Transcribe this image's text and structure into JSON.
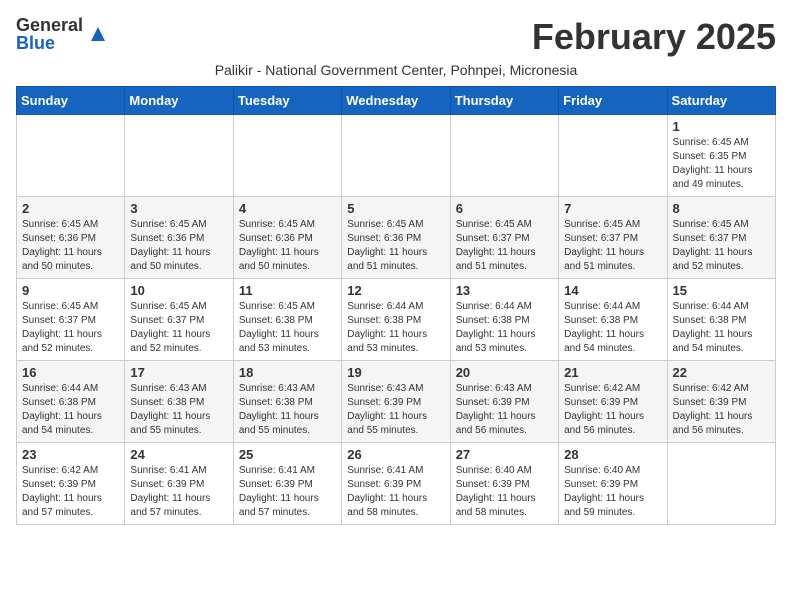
{
  "header": {
    "logo": {
      "general": "General",
      "blue": "Blue"
    },
    "title": "February 2025",
    "location": "Palikir - National Government Center, Pohnpei, Micronesia"
  },
  "weekdays": [
    "Sunday",
    "Monday",
    "Tuesday",
    "Wednesday",
    "Thursday",
    "Friday",
    "Saturday"
  ],
  "weeks": [
    [
      {
        "day": "",
        "info": ""
      },
      {
        "day": "",
        "info": ""
      },
      {
        "day": "",
        "info": ""
      },
      {
        "day": "",
        "info": ""
      },
      {
        "day": "",
        "info": ""
      },
      {
        "day": "",
        "info": ""
      },
      {
        "day": "1",
        "info": "Sunrise: 6:45 AM\nSunset: 6:35 PM\nDaylight: 11 hours and 49 minutes."
      }
    ],
    [
      {
        "day": "2",
        "info": "Sunrise: 6:45 AM\nSunset: 6:36 PM\nDaylight: 11 hours and 50 minutes."
      },
      {
        "day": "3",
        "info": "Sunrise: 6:45 AM\nSunset: 6:36 PM\nDaylight: 11 hours and 50 minutes."
      },
      {
        "day": "4",
        "info": "Sunrise: 6:45 AM\nSunset: 6:36 PM\nDaylight: 11 hours and 50 minutes."
      },
      {
        "day": "5",
        "info": "Sunrise: 6:45 AM\nSunset: 6:36 PM\nDaylight: 11 hours and 51 minutes."
      },
      {
        "day": "6",
        "info": "Sunrise: 6:45 AM\nSunset: 6:37 PM\nDaylight: 11 hours and 51 minutes."
      },
      {
        "day": "7",
        "info": "Sunrise: 6:45 AM\nSunset: 6:37 PM\nDaylight: 11 hours and 51 minutes."
      },
      {
        "day": "8",
        "info": "Sunrise: 6:45 AM\nSunset: 6:37 PM\nDaylight: 11 hours and 52 minutes."
      }
    ],
    [
      {
        "day": "9",
        "info": "Sunrise: 6:45 AM\nSunset: 6:37 PM\nDaylight: 11 hours and 52 minutes."
      },
      {
        "day": "10",
        "info": "Sunrise: 6:45 AM\nSunset: 6:37 PM\nDaylight: 11 hours and 52 minutes."
      },
      {
        "day": "11",
        "info": "Sunrise: 6:45 AM\nSunset: 6:38 PM\nDaylight: 11 hours and 53 minutes."
      },
      {
        "day": "12",
        "info": "Sunrise: 6:44 AM\nSunset: 6:38 PM\nDaylight: 11 hours and 53 minutes."
      },
      {
        "day": "13",
        "info": "Sunrise: 6:44 AM\nSunset: 6:38 PM\nDaylight: 11 hours and 53 minutes."
      },
      {
        "day": "14",
        "info": "Sunrise: 6:44 AM\nSunset: 6:38 PM\nDaylight: 11 hours and 54 minutes."
      },
      {
        "day": "15",
        "info": "Sunrise: 6:44 AM\nSunset: 6:38 PM\nDaylight: 11 hours and 54 minutes."
      }
    ],
    [
      {
        "day": "16",
        "info": "Sunrise: 6:44 AM\nSunset: 6:38 PM\nDaylight: 11 hours and 54 minutes."
      },
      {
        "day": "17",
        "info": "Sunrise: 6:43 AM\nSunset: 6:38 PM\nDaylight: 11 hours and 55 minutes."
      },
      {
        "day": "18",
        "info": "Sunrise: 6:43 AM\nSunset: 6:38 PM\nDaylight: 11 hours and 55 minutes."
      },
      {
        "day": "19",
        "info": "Sunrise: 6:43 AM\nSunset: 6:39 PM\nDaylight: 11 hours and 55 minutes."
      },
      {
        "day": "20",
        "info": "Sunrise: 6:43 AM\nSunset: 6:39 PM\nDaylight: 11 hours and 56 minutes."
      },
      {
        "day": "21",
        "info": "Sunrise: 6:42 AM\nSunset: 6:39 PM\nDaylight: 11 hours and 56 minutes."
      },
      {
        "day": "22",
        "info": "Sunrise: 6:42 AM\nSunset: 6:39 PM\nDaylight: 11 hours and 56 minutes."
      }
    ],
    [
      {
        "day": "23",
        "info": "Sunrise: 6:42 AM\nSunset: 6:39 PM\nDaylight: 11 hours and 57 minutes."
      },
      {
        "day": "24",
        "info": "Sunrise: 6:41 AM\nSunset: 6:39 PM\nDaylight: 11 hours and 57 minutes."
      },
      {
        "day": "25",
        "info": "Sunrise: 6:41 AM\nSunset: 6:39 PM\nDaylight: 11 hours and 57 minutes."
      },
      {
        "day": "26",
        "info": "Sunrise: 6:41 AM\nSunset: 6:39 PM\nDaylight: 11 hours and 58 minutes."
      },
      {
        "day": "27",
        "info": "Sunrise: 6:40 AM\nSunset: 6:39 PM\nDaylight: 11 hours and 58 minutes."
      },
      {
        "day": "28",
        "info": "Sunrise: 6:40 AM\nSunset: 6:39 PM\nDaylight: 11 hours and 59 minutes."
      },
      {
        "day": "",
        "info": ""
      }
    ]
  ]
}
